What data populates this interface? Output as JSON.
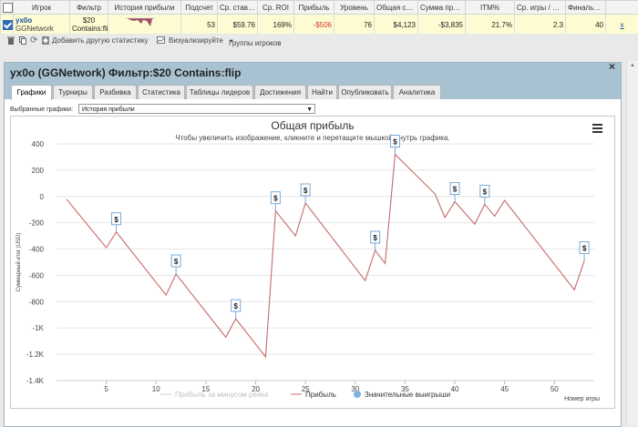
{
  "table": {
    "headers": [
      "",
      "Игрок",
      "Фильтр",
      "История прибыли",
      "Подсчет",
      "Ср. ставка",
      "Ср. ROI",
      "Прибыль",
      "Уровень",
      "Общая ставка",
      "Сумма призов",
      "ITM%",
      "Ср. игры / день",
      "Финальные",
      ""
    ],
    "row": {
      "player_name": "yx0o",
      "player_network": "GGNetwork",
      "filter_line1": "$20",
      "filter_line2": "Contains:flip",
      "count": "53",
      "avg_stake": "$59.76",
      "avg_roi": "169%",
      "profit": "-$506",
      "level": "76",
      "total_stake": "$4,123",
      "prize_sum": "-$3,835",
      "itm": "21.7%",
      "games_per_day": "2.3",
      "finals": "40",
      "close": "x"
    }
  },
  "toolbar": {
    "add_stat": "Добавить другую статистику",
    "visualize": "Визуализируйте",
    "player_groups": "Группы игроков"
  },
  "panel": {
    "title": "yx0o (GGNetwork) Фильтр:$20 Contains:flip",
    "close": "×",
    "tabs": [
      "Графики",
      "Турниры",
      "Разбивка",
      "Статистика",
      "Таблицы лидеров",
      "Достижения",
      "Найти",
      "Опубликовать",
      "Аналитика"
    ],
    "selected_label": "Выбранные графики:",
    "selected_value": "История прибыли"
  },
  "chart_data": {
    "type": "line",
    "title": "Общая прибыль",
    "subtitle": "Чтобы увеличить изображение, кликните и перетащите мышкой внутрь графика.",
    "ylabel": "Суммарный итог (USD)",
    "xlabel": "Номер игры",
    "ylim": [
      -1400,
      400
    ],
    "xlim": [
      0,
      54
    ],
    "y_ticks": [
      "400",
      "200",
      "0",
      "-200",
      "-400",
      "-600",
      "-800",
      "-1K",
      "-1.2K",
      "-1.4K"
    ],
    "y_tick_values": [
      400,
      200,
      0,
      -200,
      -400,
      -600,
      -800,
      -1000,
      -1200,
      -1400
    ],
    "x_ticks": [
      5,
      10,
      15,
      20,
      25,
      30,
      35,
      40,
      45,
      50
    ],
    "line_color": "#c46a6a",
    "series": [
      {
        "name": "Прибыль",
        "x": [
          1,
          2,
          3,
          4,
          5,
          6,
          7,
          8,
          9,
          10,
          11,
          12,
          13,
          14,
          15,
          16,
          17,
          18,
          19,
          20,
          21,
          22,
          23,
          24,
          25,
          26,
          27,
          28,
          29,
          30,
          31,
          32,
          33,
          34,
          35,
          36,
          37,
          38,
          39,
          40,
          41,
          42,
          43,
          44,
          45,
          46,
          47,
          48,
          49,
          50,
          51,
          52,
          53
        ],
        "y": [
          -20,
          -90,
          -160,
          -230,
          -300,
          -360,
          -390,
          -460,
          -510,
          -570,
          -620,
          -670,
          -720,
          -790,
          -840,
          -900,
          -960,
          -1020,
          -1060,
          -1140,
          -1200,
          -110,
          -190,
          -270,
          -50,
          -120,
          -200,
          -270,
          -350,
          -420,
          -490,
          -560,
          -500,
          -560,
          310,
          250,
          170,
          90,
          20,
          -40,
          -100,
          -160,
          -210,
          -90,
          -150,
          -210,
          -270,
          -330,
          -390,
          -450,
          -510,
          -570,
          -620
        ]
      }
    ],
    "profit_points": [
      [
        1,
        -20
      ],
      [
        5,
        -390
      ],
      [
        6,
        -270
      ],
      [
        11,
        -750
      ],
      [
        12,
        -590
      ],
      [
        17,
        -1070
      ],
      [
        18,
        -930
      ],
      [
        21,
        -1220
      ],
      [
        22,
        -110
      ],
      [
        24,
        -300
      ],
      [
        25,
        -50
      ],
      [
        31,
        -640
      ],
      [
        32,
        -410
      ],
      [
        33,
        -510
      ],
      [
        34,
        320
      ],
      [
        38,
        20
      ],
      [
        39,
        -160
      ],
      [
        40,
        -40
      ],
      [
        42,
        -210
      ],
      [
        43,
        -60
      ],
      [
        44,
        -150
      ],
      [
        45,
        -30
      ],
      [
        52,
        -710
      ],
      [
        53,
        -490
      ]
    ],
    "big_win_markers": [
      6,
      12,
      18,
      22,
      25,
      32,
      34,
      40,
      43,
      53
    ],
    "marker_label": "$",
    "legend": [
      "Прибыль за минусом рейка",
      "Прибыль",
      "Значительные выигрыши"
    ],
    "legend_placement": "bottom"
  }
}
